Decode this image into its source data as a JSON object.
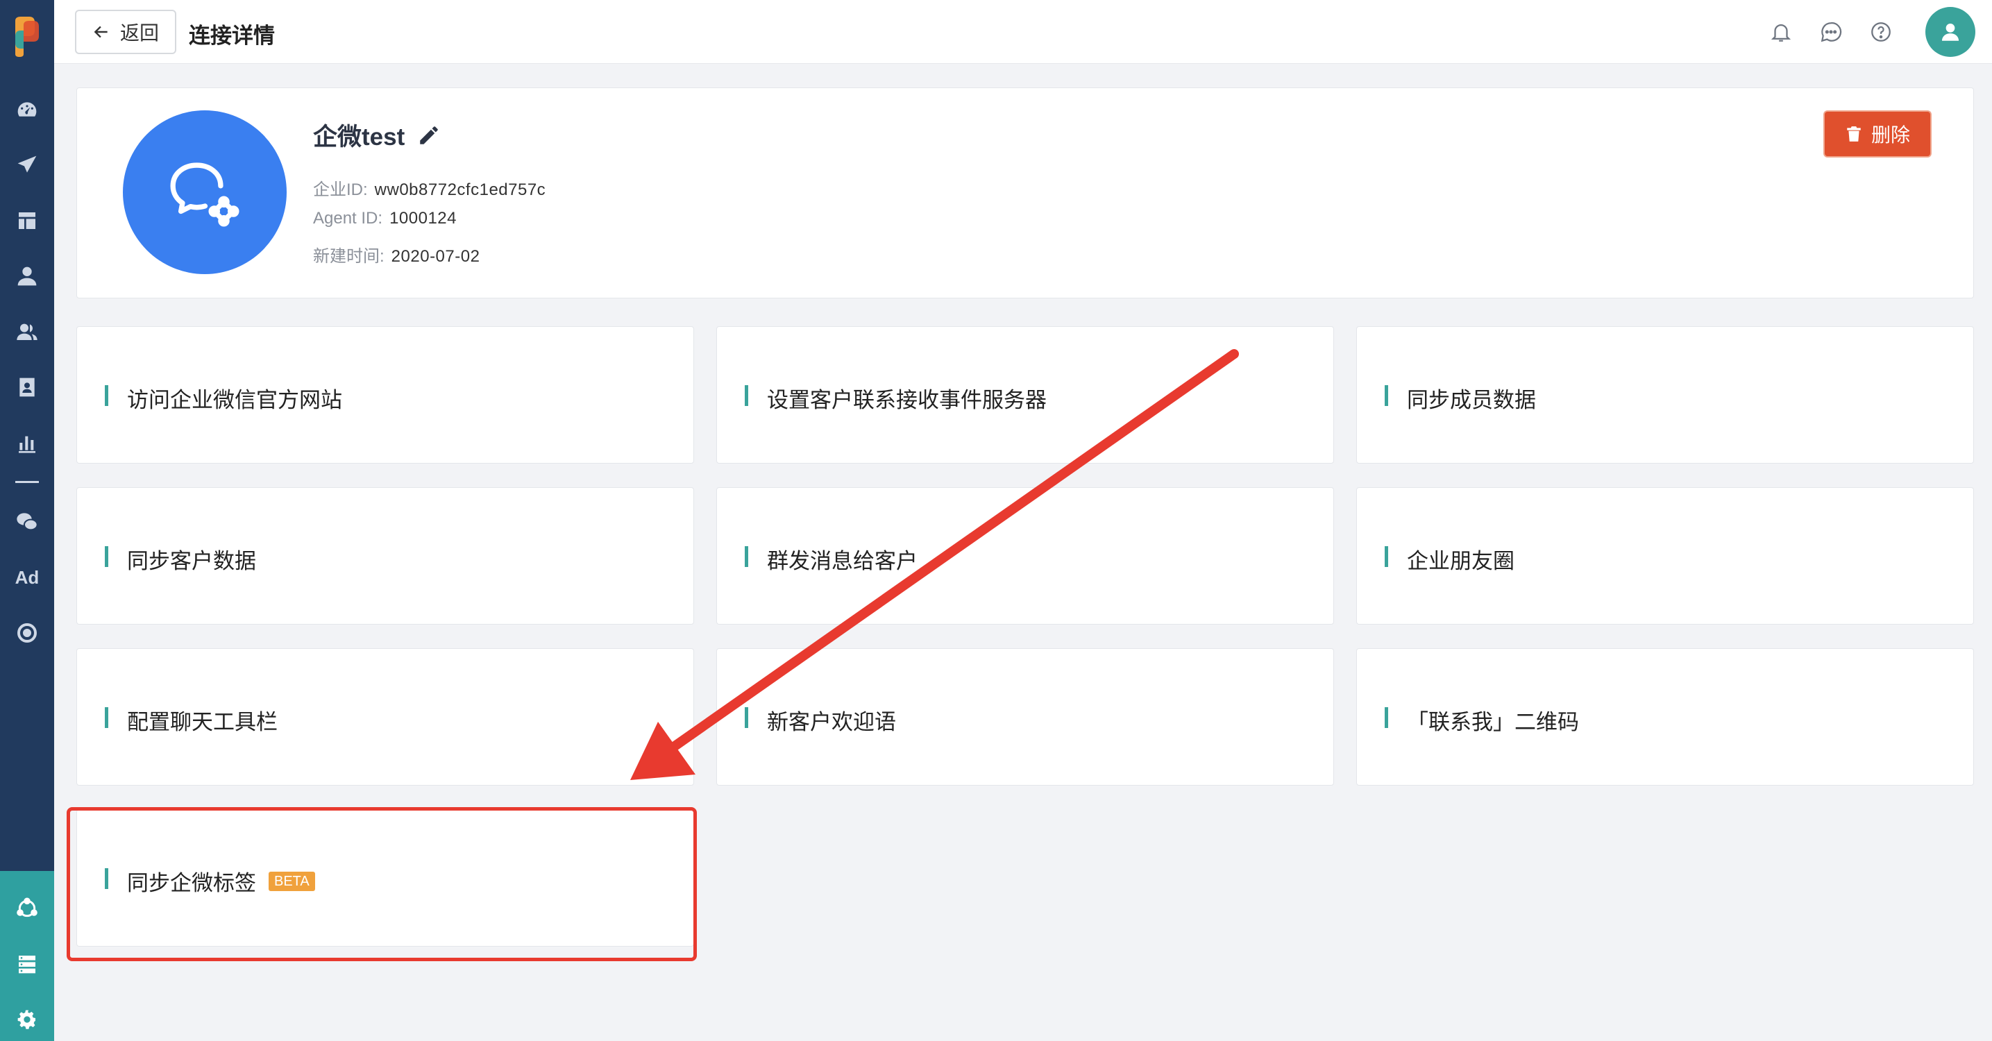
{
  "header": {
    "back_label": "返回",
    "title": "连接详情",
    "icons": [
      "bell-icon",
      "chat-icon",
      "help-icon",
      "user-avatar-icon"
    ]
  },
  "sidebar": {
    "items": [
      {
        "name": "dashboard-icon"
      },
      {
        "name": "send-icon"
      },
      {
        "name": "layout-icon"
      },
      {
        "name": "user-icon"
      },
      {
        "name": "users-icon"
      },
      {
        "name": "contact-card-icon"
      },
      {
        "name": "bar-chart-icon"
      },
      {
        "name": "wechat-icon"
      },
      {
        "name": "ad-icon",
        "label": "Ad"
      },
      {
        "name": "target-icon"
      }
    ],
    "bottom_items": [
      {
        "name": "connection-icon"
      },
      {
        "name": "server-icon"
      },
      {
        "name": "gear-icon"
      }
    ]
  },
  "connection": {
    "name": "企微test",
    "enterprise_id_label": "企业ID:",
    "enterprise_id": "ww0b8772cfc1ed757c",
    "agent_id_label": "Agent ID:",
    "agent_id": "1000124",
    "created_label": "新建时间:",
    "created": "2020-07-02",
    "delete_label": "删除"
  },
  "features": [
    {
      "label": "访问企业微信官方网站"
    },
    {
      "label": "设置客户联系接收事件服务器"
    },
    {
      "label": "同步成员数据"
    },
    {
      "label": "同步客户数据"
    },
    {
      "label": "群发消息给客户"
    },
    {
      "label": "企业朋友圈"
    },
    {
      "label": "配置聊天工具栏"
    },
    {
      "label": "新客户欢迎语"
    },
    {
      "label": "「联系我」二维码"
    },
    {
      "label": "同步企微标签",
      "badge": "BETA"
    }
  ],
  "colors": {
    "sidebar": "#213a5e",
    "accent": "#3aa39b",
    "danger": "#e0502d",
    "beta": "#f0a13c",
    "annotation": "#e83a2f"
  }
}
